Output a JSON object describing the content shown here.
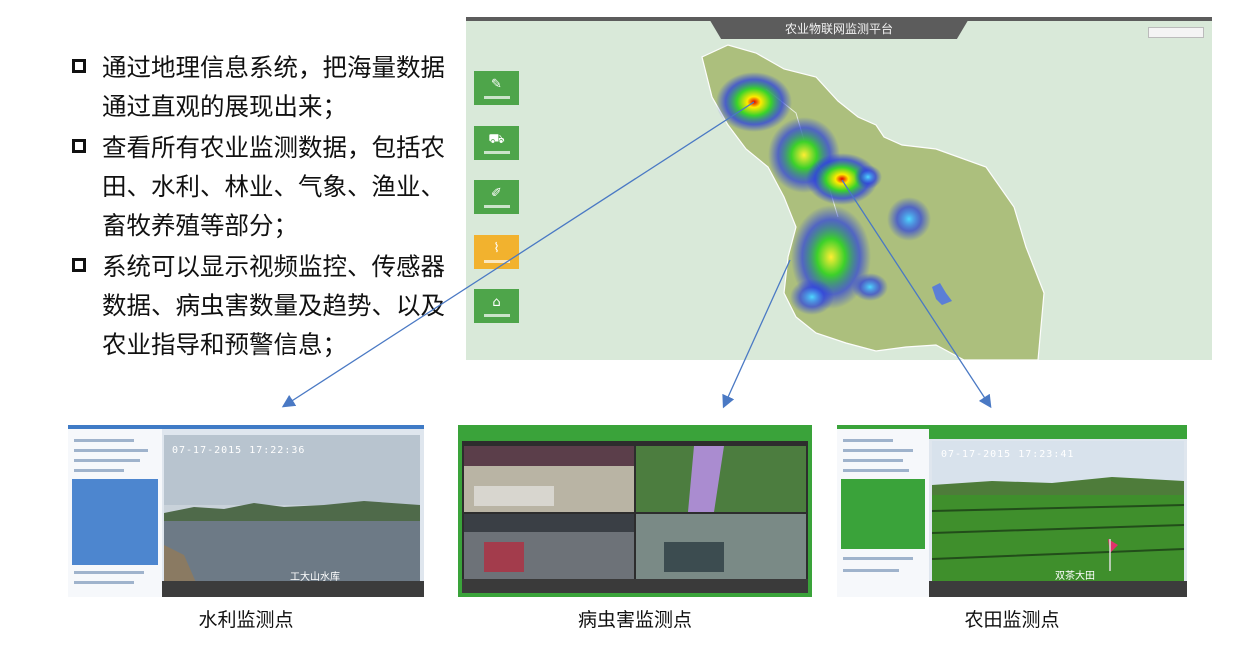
{
  "bullets": [
    {
      "text": "通过地理信息系统，把海量数据通过直观的展现出来；"
    },
    {
      "text": "查看所有农业监测数据，包括农田、水利、林业、气象、渔业、畜牧养殖等部分；"
    },
    {
      "text": "系统可以显示视频监控、传感器数据、病虫害数量及趋势、以及农业指导和预警信息；"
    }
  ],
  "map": {
    "title": "农业物联网监测平台",
    "side_buttons": [
      {
        "icon": "leaf-icon",
        "glyph": "✎"
      },
      {
        "icon": "tractor-icon",
        "glyph": "⛟"
      },
      {
        "icon": "pen-icon",
        "glyph": "✐"
      },
      {
        "icon": "chart-icon",
        "glyph": "⌇"
      },
      {
        "icon": "house-icon",
        "glyph": "⌂"
      }
    ],
    "active_button": 3
  },
  "thumbnails": {
    "water": {
      "caption": "水利监测点",
      "timestamp": "07-17-2015 17:22:36",
      "label": "工大山水库"
    },
    "pest": {
      "caption": "病虫害监测点"
    },
    "farm": {
      "caption": "农田监测点",
      "timestamp": "07-17-2015 17:23:41",
      "label": "双茶大田"
    }
  },
  "colors": {
    "platform_green": "#4ea54a",
    "active_orange": "#f2b22e",
    "water_blue": "#3f7bc6",
    "arrow_blue": "#4a79c4"
  }
}
